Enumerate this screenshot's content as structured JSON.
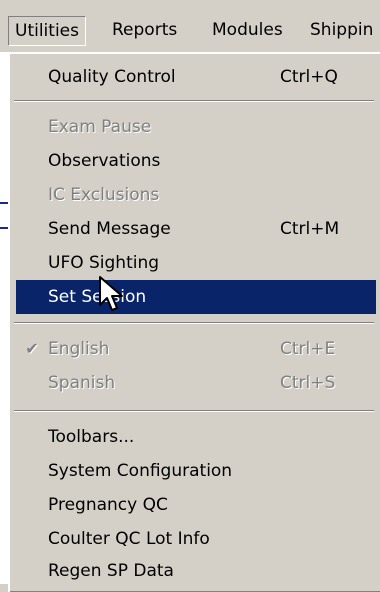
{
  "menubar": {
    "items": [
      {
        "label": "Utilities"
      },
      {
        "label": "Reports"
      },
      {
        "label": "Modules"
      },
      {
        "label": "Shippin"
      }
    ]
  },
  "menu": {
    "items": [
      {
        "label": "Quality Control",
        "shortcut": "Ctrl+Q",
        "state": "enabled"
      },
      {
        "label": "Exam Pause",
        "shortcut": "",
        "state": "disabled"
      },
      {
        "label": "Observations",
        "shortcut": "",
        "state": "enabled"
      },
      {
        "label": "IC Exclusions",
        "shortcut": "",
        "state": "disabled"
      },
      {
        "label": "Send Message",
        "shortcut": "Ctrl+M",
        "state": "enabled"
      },
      {
        "label": "UFO Sighting",
        "shortcut": "",
        "state": "enabled"
      },
      {
        "label": "Set Session",
        "shortcut": "",
        "state": "selected"
      },
      {
        "label": "English",
        "shortcut": "Ctrl+E",
        "state": "disabled",
        "checked": true
      },
      {
        "label": "Spanish",
        "shortcut": "Ctrl+S",
        "state": "disabled"
      },
      {
        "label": "Toolbars...",
        "shortcut": "",
        "state": "enabled"
      },
      {
        "label": "System Configuration",
        "shortcut": "",
        "state": "enabled"
      },
      {
        "label": "Pregnancy QC",
        "shortcut": "",
        "state": "enabled"
      },
      {
        "label": "Coulter QC Lot Info",
        "shortcut": "",
        "state": "enabled"
      },
      {
        "label": "Regen SP Data",
        "shortcut": "",
        "state": "enabled"
      }
    ]
  },
  "colors": {
    "menu_bg": "#d4d0c8",
    "highlight": "#0a246a",
    "disabled_text": "#808080"
  },
  "icons": {
    "check": "check-icon",
    "cursor": "arrow-cursor-icon"
  }
}
